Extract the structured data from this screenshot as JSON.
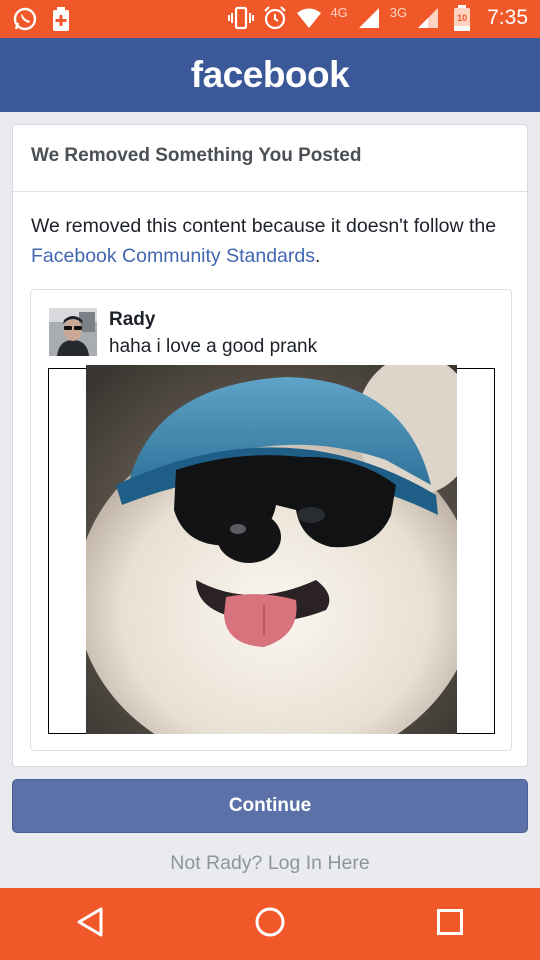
{
  "status_bar": {
    "net_4g": "4G",
    "net_3g": "3G",
    "battery_level": "10",
    "time": "7:35"
  },
  "header": {
    "brand": "facebook"
  },
  "notice": {
    "title": "We Removed Something You Posted",
    "message_before_link": "We removed this content because it doesn't follow the ",
    "link_text": "Facebook Community Standards",
    "message_after_link": "."
  },
  "post": {
    "author": "Rady",
    "text": "haha i love a good prank"
  },
  "actions": {
    "continue_label": "Continue",
    "login_link": "Not Rady? Log In Here"
  },
  "colors": {
    "status_bar": "#f0582a",
    "brand_blue": "#3b5998",
    "link_blue": "#4267b2",
    "button": "#5b71a8"
  },
  "icons": {
    "status_left": [
      "whatsapp-icon",
      "battery-saver-icon"
    ],
    "status_right": [
      "vibrate-icon",
      "alarm-icon",
      "wifi-icon",
      "signal-icon",
      "signal-icon",
      "battery-icon"
    ],
    "nav": [
      "back-icon",
      "home-icon",
      "recents-icon"
    ]
  }
}
